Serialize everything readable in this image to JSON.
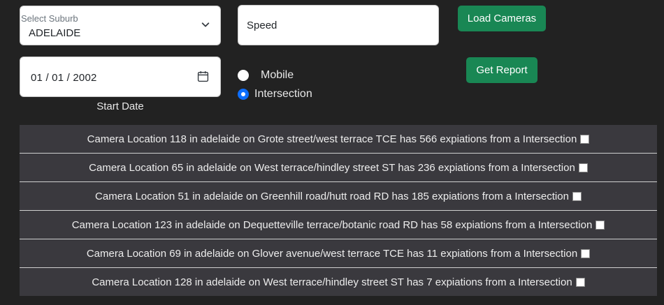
{
  "filters": {
    "suburb_label": "Select Suburb",
    "suburb_value": "ADELAIDE",
    "camera_type_value": "Speed",
    "start_date_value": "01 / 01 / 2002",
    "start_date_label": "Start Date"
  },
  "buttons": {
    "load_cameras": "Load Cameras",
    "get_report": "Get Report"
  },
  "radios": {
    "mobile": {
      "label": "Mobile",
      "checked": false
    },
    "intersection": {
      "label": "Intersection",
      "checked": true
    }
  },
  "results": [
    {
      "text": "Camera Location 118 in adelaide on Grote street/west terrace TCE has 566 expiations from a Intersection",
      "checked": false
    },
    {
      "text": "Camera Location 65 in adelaide on West terrace/hindley street ST has 236 expiations from a Intersection",
      "checked": false
    },
    {
      "text": "Camera Location 51 in adelaide on Greenhill road/hutt road RD has 185 expiations from a Intersection",
      "checked": false
    },
    {
      "text": "Camera Location 123 in adelaide on Dequetteville terrace/botanic road RD has 58 expiations from a Intersection",
      "checked": false
    },
    {
      "text": "Camera Location 69 in adelaide on Glover avenue/west terrace TCE has 11 expiations from a Intersection",
      "checked": false
    },
    {
      "text": "Camera Location 128 in adelaide on West terrace/hindley street ST has 7 expiations from a Intersection",
      "checked": false
    }
  ],
  "colors": {
    "background": "#222222",
    "row_background": "#3a393e",
    "button_green": "#198754",
    "radio_blue": "#0d6efd"
  },
  "icons": {
    "select_arrow": "chevron-down-icon",
    "date_picker": "calendar-icon"
  }
}
